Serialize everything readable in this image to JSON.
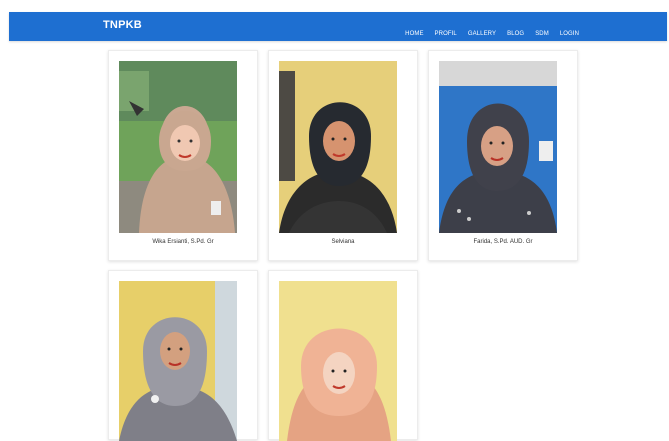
{
  "navbar": {
    "brand": "TNPKB",
    "items": [
      "HOME",
      "PROFIL",
      "GALLERY",
      "BLOG",
      "SDM",
      "LOGIN"
    ],
    "color": "#1e6fd1"
  },
  "members": [
    {
      "name": "Wika Ersianti, S.Pd. Gr"
    },
    {
      "name": "Selviana"
    },
    {
      "name": "Farida, S.Pd. AUD. Gr"
    },
    {
      "name": ""
    },
    {
      "name": ""
    }
  ]
}
